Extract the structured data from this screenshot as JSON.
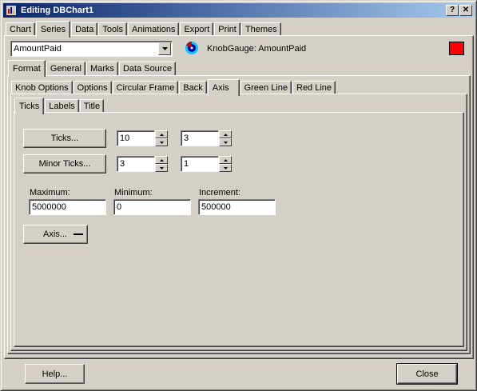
{
  "window": {
    "title": "Editing DBChart1",
    "help_button": "?",
    "close_button": "✕"
  },
  "main_tabs": [
    "Chart",
    "Series",
    "Data",
    "Tools",
    "Animations",
    "Export",
    "Print",
    "Themes"
  ],
  "main_tab_active": "Series",
  "series": {
    "combo_value": "AmountPaid",
    "series_label": "KnobGauge: AmountPaid",
    "color_swatch": "#ff0000"
  },
  "series_tabs": [
    "Format",
    "General",
    "Marks",
    "Data Source"
  ],
  "format_tabs": [
    "Knob Options",
    "Options",
    "Circular Frame",
    "Back",
    "Axis",
    "Green Line",
    "Red Line"
  ],
  "axis_tabs": [
    "Ticks",
    "Labels",
    "Title"
  ],
  "ticks": {
    "ticks_button": "Ticks...",
    "ticks_value1": "10",
    "ticks_value2": "3",
    "minor_button": "Minor Ticks...",
    "minor_value1": "3",
    "minor_value2": "1"
  },
  "range": {
    "maximum_label": "Maximum:",
    "maximum_value": "5000000",
    "minimum_label": "Minimum:",
    "minimum_value": "0",
    "increment_label": "Increment:",
    "increment_value": "500000"
  },
  "axis_button": "Axis...",
  "footer": {
    "help": "Help...",
    "close": "Close"
  }
}
